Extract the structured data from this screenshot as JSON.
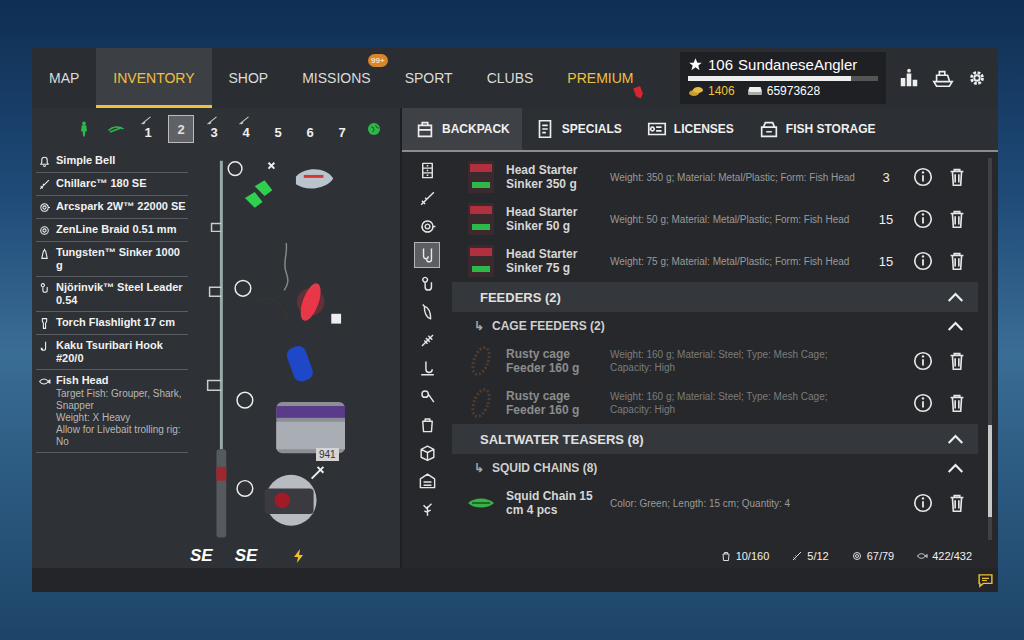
{
  "nav": {
    "tabs": [
      {
        "label": "MAP",
        "selected": false,
        "kind": "plain",
        "badge": ""
      },
      {
        "label": "INVENTORY",
        "selected": true,
        "kind": "plain",
        "badge": ""
      },
      {
        "label": "SHOP",
        "selected": false,
        "kind": "plain",
        "badge": ""
      },
      {
        "label": "MISSIONS",
        "selected": false,
        "kind": "badge",
        "badge": "99+"
      },
      {
        "label": "SPORT",
        "selected": false,
        "kind": "plain",
        "badge": ""
      },
      {
        "label": "CLUBS",
        "selected": false,
        "kind": "plain",
        "badge": ""
      },
      {
        "label": "PREMIUM",
        "selected": false,
        "kind": "premium",
        "badge": ""
      }
    ]
  },
  "player": {
    "level": "106",
    "name": "SundaneseAngler",
    "xp_level": 0.86,
    "gold": "1406",
    "silver": "65973628"
  },
  "rod_slots": [
    {
      "label": "",
      "kind": "angler",
      "selected": false,
      "rigged": false
    },
    {
      "label": "",
      "kind": "rods",
      "selected": false,
      "rigged": false
    },
    {
      "label": "1",
      "kind": "slot",
      "selected": false,
      "rigged": true
    },
    {
      "label": "2",
      "kind": "slot",
      "selected": true,
      "rigged": false
    },
    {
      "label": "3",
      "kind": "slot",
      "selected": false,
      "rigged": true
    },
    {
      "label": "4",
      "kind": "slot",
      "selected": false,
      "rigged": true
    },
    {
      "label": "5",
      "kind": "slot",
      "selected": false,
      "rigged": false
    },
    {
      "label": "6",
      "kind": "slot",
      "selected": false,
      "rigged": false
    },
    {
      "label": "7",
      "kind": "slot",
      "selected": false,
      "rigged": false
    },
    {
      "label": "",
      "kind": "globe",
      "selected": false,
      "rigged": false
    }
  ],
  "tackle": [
    {
      "kind": "bell",
      "name": "Simple Bell",
      "details": []
    },
    {
      "kind": "rod",
      "name": "Chillarc™ 180 SE",
      "details": []
    },
    {
      "kind": "reel",
      "name": "Arcspark 2W™ 22000 SE",
      "details": []
    },
    {
      "kind": "line",
      "name": "ZenLine Braid 0.51 mm",
      "details": []
    },
    {
      "kind": "sinker",
      "name": "Tungsten™ Sinker 1000 g",
      "details": []
    },
    {
      "kind": "leader",
      "name": "Njörinvik™ Steel Leader 0.54",
      "details": []
    },
    {
      "kind": "flashlight",
      "name": "Torch Flashlight 17 cm",
      "details": []
    },
    {
      "kind": "hook",
      "name": "Kaku Tsuribari Hook #20/0",
      "details": []
    },
    {
      "kind": "bait",
      "name": "Fish Head",
      "details": [
        "Target Fish: Grouper, Shark, Snapper",
        "Weight: X Heavy",
        "Allow for Livebait trolling rig: No"
      ]
    }
  ],
  "rod_view": {
    "line_length": "941",
    "logos": [
      "SE",
      "SE"
    ]
  },
  "backpack": {
    "tabs": [
      {
        "label": "BACKPACK",
        "selected": true,
        "kind": "backpack"
      },
      {
        "label": "SPECIALS",
        "selected": false,
        "kind": "specials"
      },
      {
        "label": "LICENSES",
        "selected": false,
        "kind": "licenses"
      },
      {
        "label": "FISH STORAGE",
        "selected": false,
        "kind": "storage"
      }
    ],
    "categories": [
      {
        "kind": "misc",
        "selected": false
      },
      {
        "kind": "rod",
        "selected": false
      },
      {
        "kind": "reel",
        "selected": false
      },
      {
        "kind": "terminal",
        "selected": true
      },
      {
        "kind": "leader",
        "selected": false
      },
      {
        "kind": "lure",
        "selected": false
      },
      {
        "kind": "flies",
        "selected": false
      },
      {
        "kind": "hooks",
        "selected": false
      },
      {
        "kind": "jig",
        "selected": false
      },
      {
        "kind": "bag",
        "selected": false
      },
      {
        "kind": "box",
        "selected": false
      },
      {
        "kind": "garage",
        "selected": false
      },
      {
        "kind": "plants",
        "selected": false
      }
    ],
    "rows": [
      {
        "kind": "item",
        "thumb": "sinker",
        "name": "Head Starter Sinker 350 g",
        "desc": "Weight: 350 g; Material: Metal/Plastic; Form: Fish Head",
        "qty": "3",
        "disabled": false
      },
      {
        "kind": "item",
        "thumb": "sinker",
        "name": "Head Starter Sinker 50 g",
        "desc": "Weight: 50 g; Material: Metal/Plastic; Form: Fish Head",
        "qty": "15",
        "disabled": false
      },
      {
        "kind": "item",
        "thumb": "sinker",
        "name": "Head Starter Sinker 75 g",
        "desc": "Weight: 75 g; Material: Metal/Plastic; Form: Fish Head",
        "qty": "15",
        "disabled": false
      },
      {
        "kind": "section",
        "label": "FEEDERS (2)",
        "expanded": true
      },
      {
        "kind": "subsection",
        "arrow": "↳",
        "label": "CAGE FEEDERS (2)",
        "expanded": true
      },
      {
        "kind": "item",
        "thumb": "feeder",
        "name": "Rusty cage Feeder 160 g",
        "desc": "Weight: 160 g; Material: Steel; Type: Mesh Cage; Capacity: High",
        "qty": "",
        "disabled": true
      },
      {
        "kind": "item",
        "thumb": "feeder",
        "name": "Rusty cage Feeder 160 g",
        "desc": "Weight: 160 g; Material: Steel; Type: Mesh Cage; Capacity: High",
        "qty": "",
        "disabled": true
      },
      {
        "kind": "section",
        "label": "SALTWATER TEASERS (8)",
        "expanded": true
      },
      {
        "kind": "subsection",
        "arrow": "↳",
        "label": "SQUID CHAINS (8)",
        "expanded": true
      },
      {
        "kind": "item",
        "thumb": "squid",
        "name": "Squid Chain 15 cm 4 pcs",
        "desc": "Color: Green; Length: 15 cm; Quantity: 4",
        "qty": "",
        "disabled": false
      }
    ],
    "scroll": {
      "offset": 0.7,
      "size": 0.24
    },
    "status": [
      {
        "kind": "bag",
        "value": "10/160"
      },
      {
        "kind": "rod",
        "value": "5/12"
      },
      {
        "kind": "line",
        "value": "67/79"
      },
      {
        "kind": "bait",
        "value": "422/432"
      }
    ]
  }
}
